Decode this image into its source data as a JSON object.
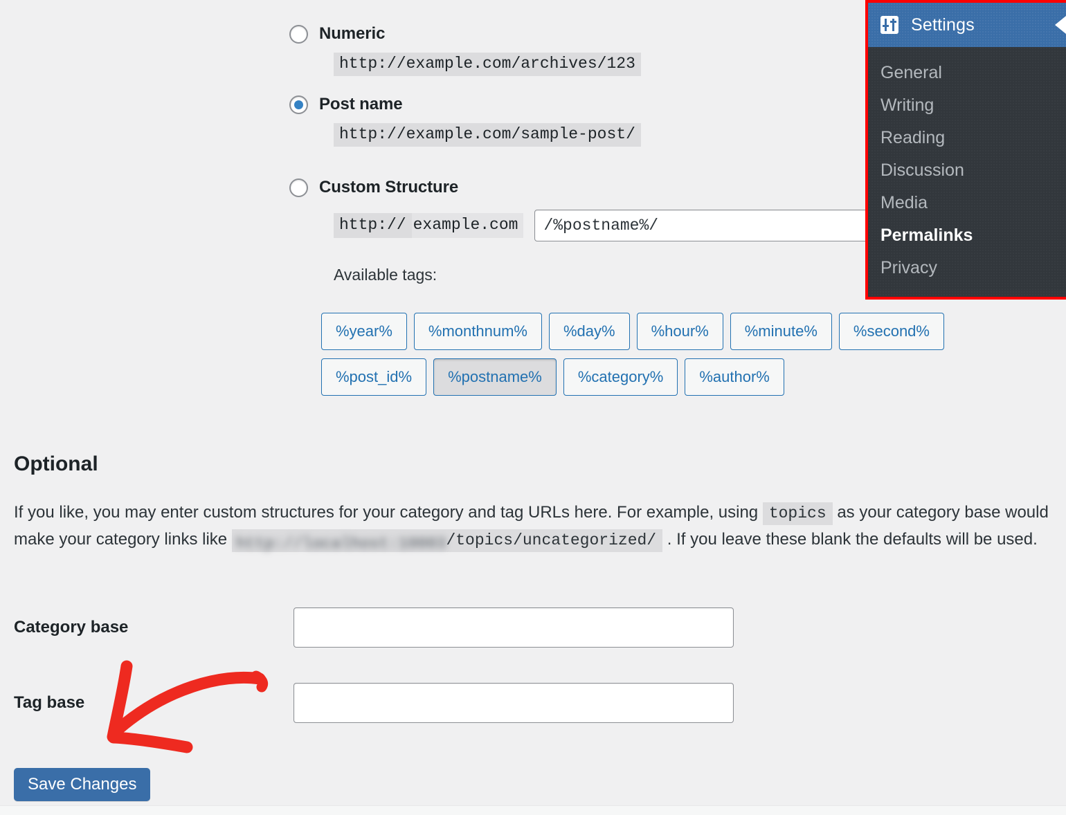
{
  "permalink_options": [
    {
      "id": "numeric",
      "label": "Numeric",
      "example": "http://example.com/archives/123",
      "selected": false
    },
    {
      "id": "post-name",
      "label": "Post name",
      "example": "http://example.com/sample-post/",
      "selected": true
    }
  ],
  "custom_structure": {
    "label": "Custom Structure",
    "selected": false,
    "protocol": "http://",
    "host": "example.com",
    "value": "/%postname%/",
    "available_tags_label": "Available tags:"
  },
  "tags": {
    "row1": [
      "%year%",
      "%monthnum%",
      "%day%",
      "%hour%",
      "%minute%",
      "%second%"
    ],
    "row2": [
      "%post_id%",
      "%postname%",
      "%category%",
      "%author%"
    ],
    "active": "%postname%"
  },
  "optional": {
    "heading": "Optional",
    "text_before_code": "If you like, you may enter custom structures for your category and tag URLs here. For example, using ",
    "code_topics": "topics",
    "text_after_code": " as your category base would make your category links like ",
    "blurred_url": "http://localhost:10003",
    "code_path": "/topics/uncategorized/",
    "text_end": " . If you leave these blank the defaults will be used."
  },
  "fields": [
    {
      "id": "category-base",
      "label": "Category base",
      "value": "",
      "placeholder": ""
    },
    {
      "id": "tag-base",
      "label": "Tag base",
      "value": "",
      "placeholder": ""
    }
  ],
  "save_button": {
    "label": "Save Changes"
  },
  "admin_menu": {
    "header": {
      "title": "Settings",
      "icon": "settings-sliders-icon"
    },
    "items": [
      {
        "label": "General",
        "current": false
      },
      {
        "label": "Writing",
        "current": false
      },
      {
        "label": "Reading",
        "current": false
      },
      {
        "label": "Discussion",
        "current": false
      },
      {
        "label": "Media",
        "current": false
      },
      {
        "label": "Permalinks",
        "current": true
      },
      {
        "label": "Privacy",
        "current": false
      }
    ],
    "highlight_color": "#ff0000"
  },
  "annotation": {
    "type": "hand-drawn-arrow",
    "color": "#ee2a20",
    "points_to": "Save Changes"
  },
  "colors": {
    "page_background": "#f0f0f1",
    "accent_blue": "#2271b1",
    "button_blue": "#3a6ea8",
    "menu_dark": "#32373c",
    "annotation_red": "#ee2a20"
  }
}
